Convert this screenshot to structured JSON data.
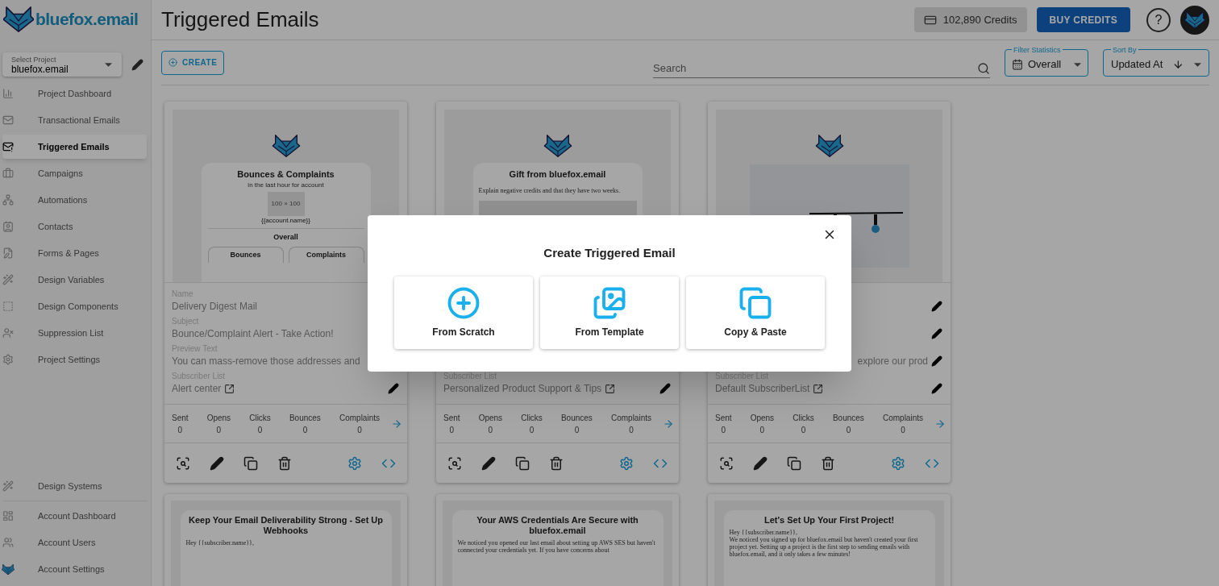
{
  "brand": {
    "name": "bluefox.email"
  },
  "project_select": {
    "label": "Select Project",
    "value": "bluefox.email"
  },
  "sidebar": {
    "items": [
      {
        "label": "Project Dashboard",
        "selected": false
      },
      {
        "label": "Transactional Emails",
        "selected": false
      },
      {
        "label": "Triggered Emails",
        "selected": true
      },
      {
        "label": "Campaigns",
        "selected": false
      },
      {
        "label": "Automations",
        "selected": false
      },
      {
        "label": "Contacts",
        "selected": false
      },
      {
        "label": "Forms & Pages",
        "selected": false
      },
      {
        "label": "Design Variables",
        "selected": false
      },
      {
        "label": "Design Components",
        "selected": false
      },
      {
        "label": "Suppression List",
        "selected": false
      },
      {
        "label": "Project Settings",
        "selected": false
      }
    ],
    "bottom_items": [
      {
        "label": "Design Systems",
        "selected": false
      },
      {
        "label": "Account Dashboard",
        "selected": false
      },
      {
        "label": "Account Users",
        "selected": false
      },
      {
        "label": "Account Settings",
        "selected": false
      }
    ]
  },
  "header": {
    "title": "Triggered Emails",
    "credits": "102,890 Credits",
    "buy_button": "BUY CREDITS",
    "help": "?"
  },
  "toolbar": {
    "create_button": "CREATE",
    "search": {
      "placeholder": "Search"
    },
    "filter": {
      "label": "Filter Statistics",
      "value": "Overall"
    },
    "sort": {
      "label": "Sort By",
      "value": "Updated At"
    }
  },
  "cards": [
    {
      "kind": "stats",
      "preview": {
        "title": "Bounces & Complaints",
        "subtitle": "in the last hour for account",
        "image_label": "100 × 100",
        "account": "{{account.name}}",
        "section": "Overall",
        "tabs": [
          "Bounces",
          "Complaints"
        ]
      },
      "name": {
        "label": "Name",
        "value": "Delivery Digest Mail"
      },
      "subject": {
        "label": "Subject",
        "value": "Bounce/Complaint Alert - Take Action!"
      },
      "preview_text": {
        "label": "Preview Text",
        "value": "You can mass-remove those addresses and"
      },
      "subscriber_list": {
        "label": "Subscriber List",
        "value": "Alert center"
      },
      "stats": [
        {
          "label": "Sent",
          "value": "0"
        },
        {
          "label": "Opens",
          "value": "0"
        },
        {
          "label": "Clicks",
          "value": "0"
        },
        {
          "label": "Bounces",
          "value": "0"
        },
        {
          "label": "Complaints",
          "value": "0"
        }
      ]
    },
    {
      "kind": "text",
      "preview": {
        "title": "Gift from bluefox.email",
        "body": "Explain negative credits and that they have two weeks."
      },
      "subscriber_list": {
        "label": "Subscriber List",
        "value": "Personalized Product Support & Tips"
      },
      "stats": [
        {
          "label": "Sent",
          "value": "0"
        },
        {
          "label": "Opens",
          "value": "0"
        },
        {
          "label": "Clicks",
          "value": "0"
        },
        {
          "label": "Bounces",
          "value": "0"
        },
        {
          "label": "Complaints",
          "value": "0"
        }
      ]
    },
    {
      "kind": "photo",
      "preview_text": {
        "value": "explore our prod"
      },
      "subscriber_list": {
        "label": "Subscriber List",
        "value": "Default SubscriberList"
      },
      "stats": [
        {
          "label": "Sent",
          "value": "0"
        },
        {
          "label": "Opens",
          "value": "0"
        },
        {
          "label": "Clicks",
          "value": "0"
        },
        {
          "label": "Bounces",
          "value": "0"
        },
        {
          "label": "Complaints",
          "value": "0"
        }
      ]
    }
  ],
  "cards_row_2": [
    {
      "title": "Keep Your Email Deliverability Strong - Set Up Webhooks",
      "body": "Hey {{subscriber.name}},"
    },
    {
      "title": "Your AWS Credentials Are Secure with bluefox.email",
      "body": "We noticed you opened our last email about setting up AWS SES but haven't connected your credentials yet. If you have concerns about"
    },
    {
      "title": "Let's Set Up Your First Project!",
      "body": "Hey {{subscriber.name}},\nWe noticed you signed up for bluefox.email but haven't created your first project yet. Setting up a project is the first step to sending emails with bluefox.email, and it only takes a few minutes!"
    }
  ],
  "dialog": {
    "title": "Create Triggered Email",
    "options": [
      {
        "kind": "scratch",
        "label": "From Scratch"
      },
      {
        "kind": "template",
        "label": "From Template"
      },
      {
        "kind": "copy",
        "label": "Copy & Paste"
      }
    ]
  }
}
